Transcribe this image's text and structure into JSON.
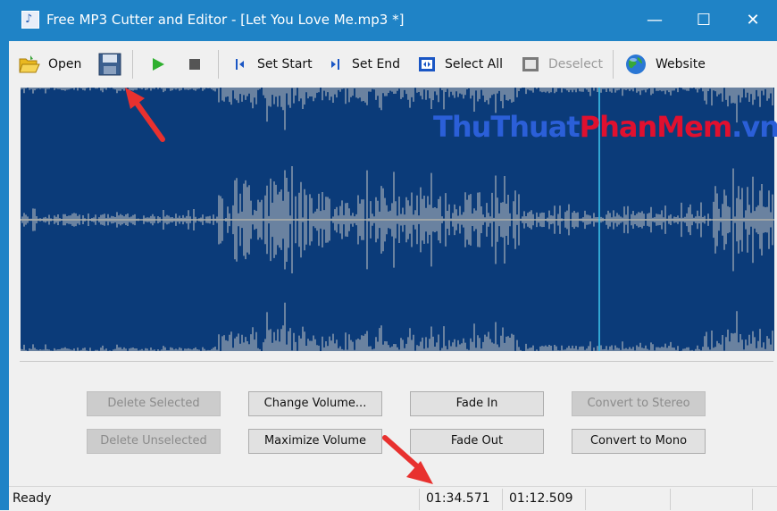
{
  "window": {
    "title": "Free MP3 Cutter and Editor - [Let You Love Me.mp3 *]",
    "icon": "mp3-app-icon",
    "controls": {
      "minimize": "—",
      "maximize": "☐",
      "close": "✕"
    }
  },
  "toolbar": {
    "open_label": "Open",
    "set_start_label": "Set Start",
    "set_end_label": "Set End",
    "select_all_label": "Select All",
    "deselect_label": "Deselect",
    "website_label": "Website"
  },
  "watermark": {
    "part1": "ThuThuat",
    "part2": "PhanMem",
    "part3": ".vn"
  },
  "buttons": {
    "delete_selected": "Delete Selected",
    "delete_unselected": "Delete Unselected",
    "change_volume": "Change Volume...",
    "maximize_volume": "Maximize Volume",
    "fade_in": "Fade In",
    "fade_out": "Fade Out",
    "convert_stereo": "Convert to Stereo",
    "convert_mono": "Convert to Mono"
  },
  "status": {
    "state": "Ready",
    "time1": "01:34.571",
    "time2": "01:12.509"
  },
  "colors": {
    "titlebar": "#1f83c6",
    "waveform_bg": "#0b3b79",
    "waveform_fg": "#c8c8c8",
    "cursor": "#3fc9f0",
    "watermark_blue": "#2b5fd8",
    "watermark_red": "#e0102f",
    "arrow": "#e8312f"
  }
}
